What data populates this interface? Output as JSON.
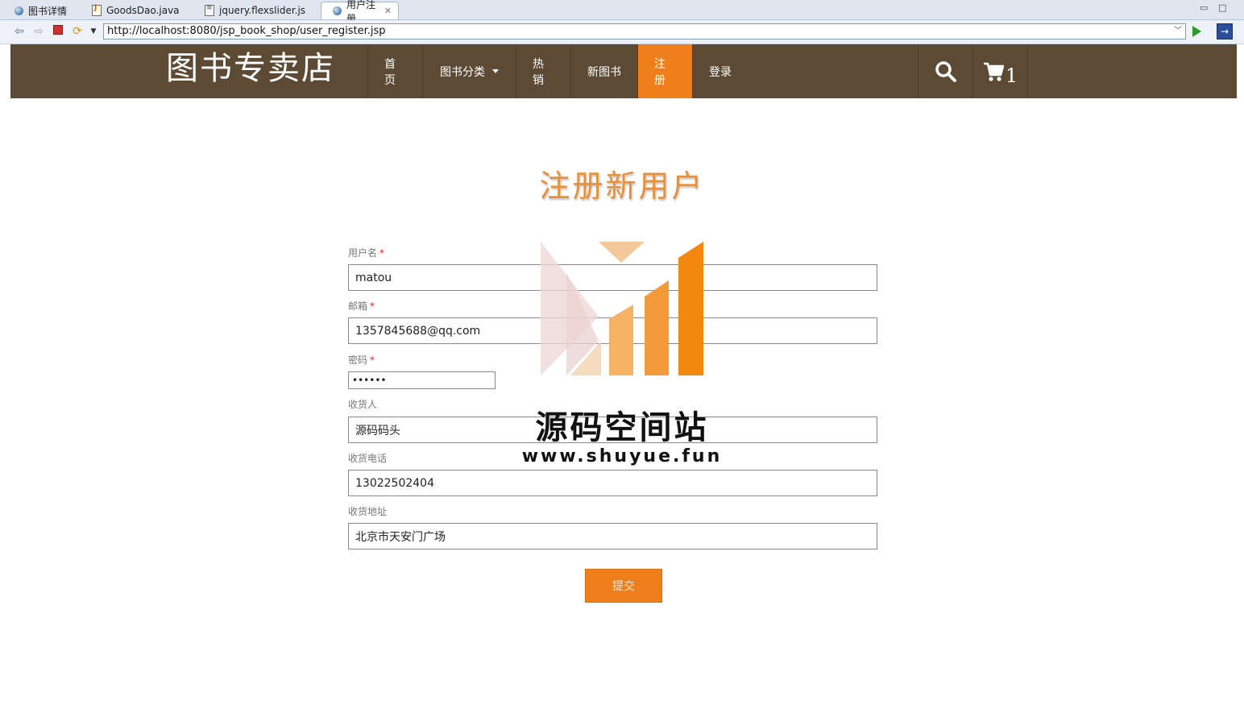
{
  "browser": {
    "tabs": [
      {
        "label": "图书详情",
        "icon": "globe-icon"
      },
      {
        "label": "GoodsDao.java",
        "icon": "java-file-icon"
      },
      {
        "label": "jquery.flexslider.js",
        "icon": "js-file-icon"
      },
      {
        "label": "用户注册",
        "icon": "globe-icon"
      }
    ],
    "active_tab_close": "✕",
    "url": "http://localhost:8080/jsp_book_shop/user_register.jsp"
  },
  "header": {
    "brand": "图书专卖店",
    "menu": [
      {
        "label": "首页"
      },
      {
        "label": "图书分类"
      },
      {
        "label": "热销"
      },
      {
        "label": "新图书"
      },
      {
        "label": "注册"
      },
      {
        "label": "登录"
      }
    ],
    "active_menu": "注册",
    "cart_count": "1",
    "colors": {
      "header_bg": "#5d4a35",
      "accent": "#ef7f1a"
    }
  },
  "form": {
    "title": "注册新用户",
    "fields": {
      "username": {
        "label": "用户名",
        "required": "*",
        "value": "matou"
      },
      "email": {
        "label": "邮箱",
        "required": "*",
        "value": "1357845688@qq.com"
      },
      "password": {
        "label": "密码",
        "required": "*",
        "value": "••••••"
      },
      "receiver": {
        "label": "收货人",
        "value": "源码码头"
      },
      "phone": {
        "label": "收货电话",
        "value": "13022502404"
      },
      "address": {
        "label": "收货地址",
        "value": "北京市天安门广场"
      }
    },
    "submit_label": "提交"
  },
  "watermark": {
    "name": "源码空间站",
    "url": "www.shuyue.fun"
  }
}
